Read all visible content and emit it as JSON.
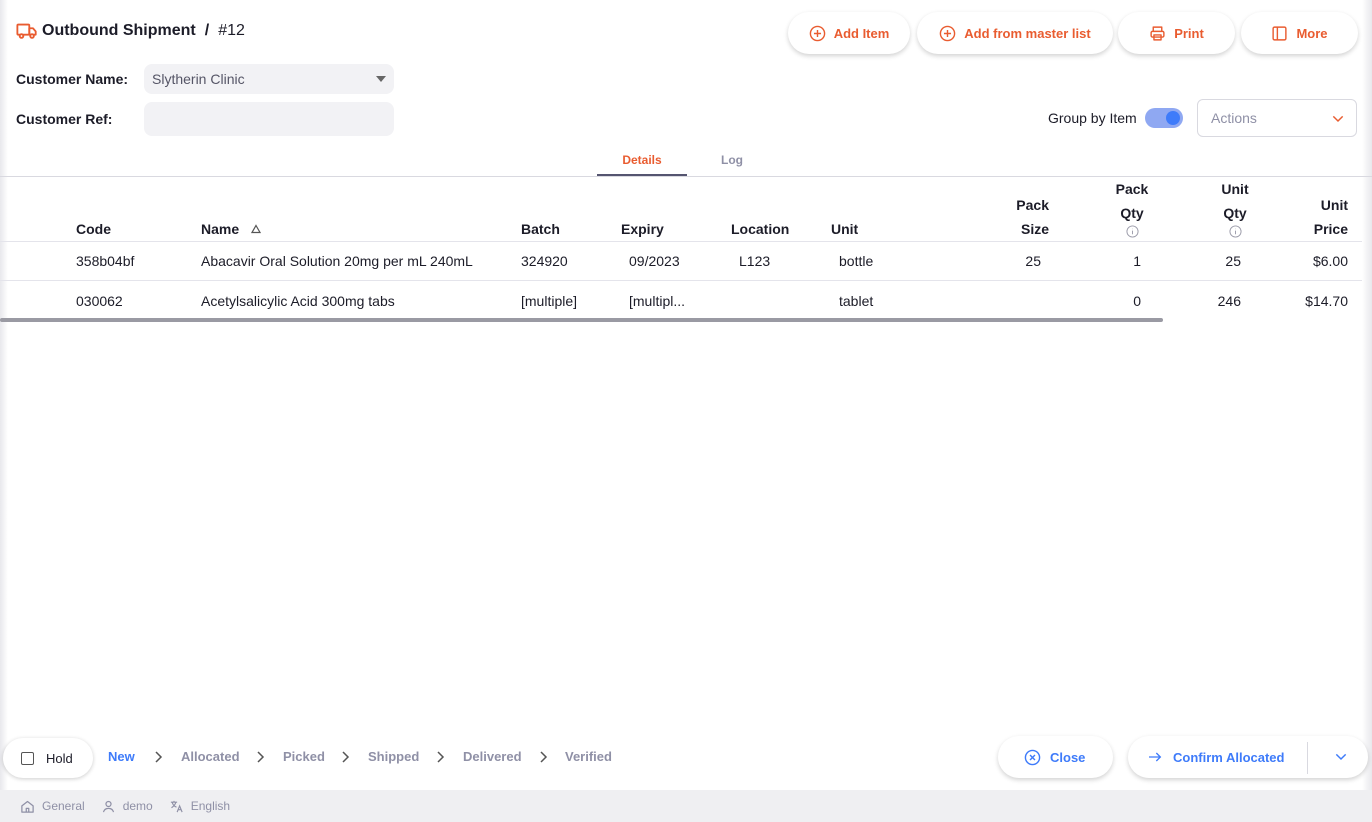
{
  "header": {
    "title": "Outbound Shipment",
    "separator": "/",
    "number": "#12",
    "buttons": {
      "add_item": "Add Item",
      "add_from_master_list": "Add from master list",
      "print": "Print",
      "more": "More"
    }
  },
  "form": {
    "customer_name_label": "Customer Name:",
    "customer_name_value": "Slytherin Clinic",
    "customer_ref_label": "Customer Ref:",
    "customer_ref_value": ""
  },
  "toolbar": {
    "group_by_item_label": "Group by Item",
    "group_by_item_on": true,
    "actions_placeholder": "Actions"
  },
  "tabs": [
    {
      "label": "Details",
      "active": true
    },
    {
      "label": "Log",
      "active": false
    }
  ],
  "table": {
    "columns": {
      "code": "Code",
      "name": "Name",
      "batch": "Batch",
      "expiry": "Expiry",
      "location": "Location",
      "unit": "Unit",
      "pack_size_1": "Pack",
      "pack_size_2": "Size",
      "pack_qty_1": "Pack",
      "pack_qty_2": "Qty",
      "unit_qty_1": "Unit",
      "unit_qty_2": "Qty",
      "unit_price_1": "Unit",
      "unit_price_2": "Price"
    },
    "sort_column": "Name",
    "sort_direction": "ascending",
    "rows": [
      {
        "code": "358b04bf",
        "name": "Abacavir Oral Solution 20mg per mL 240mL",
        "batch": "324920",
        "expiry": "09/2023",
        "location": "L123",
        "unit": "bottle",
        "pack_size": "25",
        "pack_qty": "1",
        "unit_qty": "25",
        "unit_price": "$6.00"
      },
      {
        "code": "030062",
        "name": "Acetylsalicylic Acid 300mg tabs",
        "batch": "[multiple]",
        "expiry": "[multipl...",
        "location": "",
        "unit": "tablet",
        "pack_size": "",
        "pack_qty": "0",
        "unit_qty": "246",
        "unit_price": "$14.70"
      }
    ]
  },
  "footer": {
    "hold_label": "Hold",
    "hold_checked": false,
    "steps": [
      "New",
      "Allocated",
      "Picked",
      "Shipped",
      "Delivered",
      "Verified"
    ],
    "active_step": "New",
    "close_label": "Close",
    "confirm_label": "Confirm Allocated"
  },
  "status_bar": {
    "store": "General",
    "user": "demo",
    "language": "English"
  },
  "colors": {
    "accent_orange": "#e95c30",
    "accent_blue": "#3e7bfa",
    "muted_gray": "#8f90a6"
  }
}
